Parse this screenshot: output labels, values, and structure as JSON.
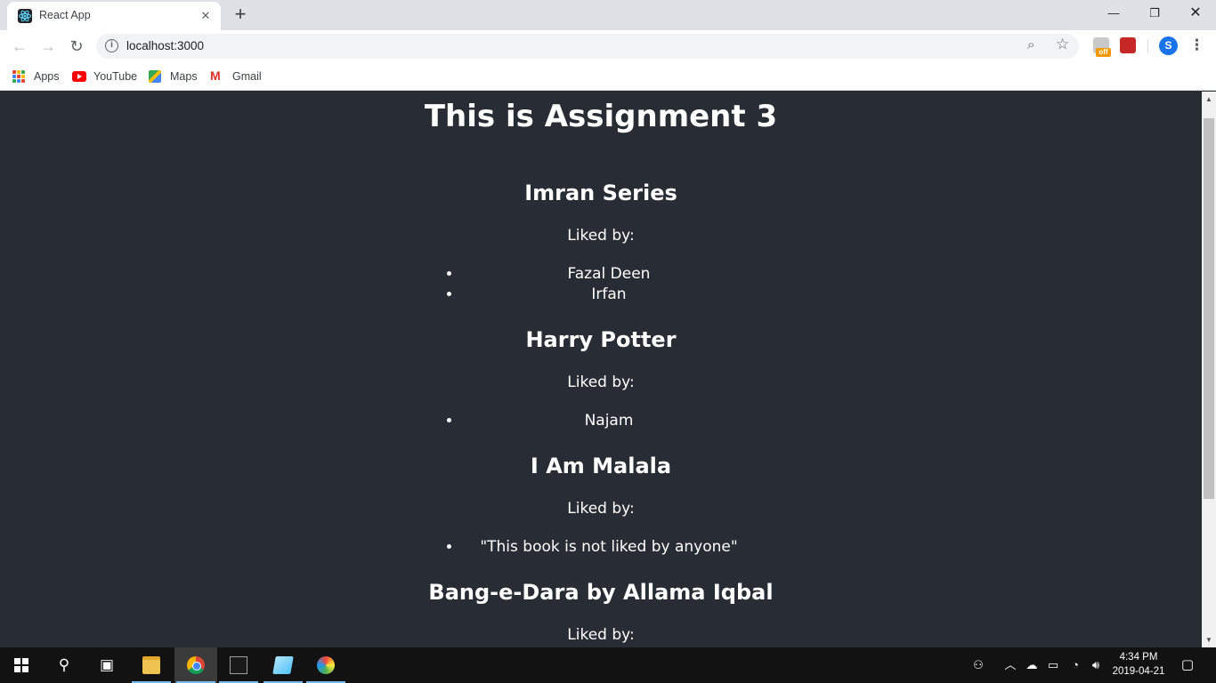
{
  "browser": {
    "tab_title": "React App",
    "url": "localhost:3000",
    "profile_initial": "S",
    "ext_badge": "off",
    "bookmarks": [
      "Apps",
      "YouTube",
      "Maps",
      "Gmail"
    ]
  },
  "page": {
    "title": "This is Assignment 3",
    "books": [
      {
        "title": "Imran Series",
        "liked_label": "Liked by:",
        "likers": [
          "Fazal Deen",
          "Irfan"
        ]
      },
      {
        "title": "Harry Potter",
        "liked_label": "Liked by:",
        "likers": [
          "Najam"
        ]
      },
      {
        "title": "I Am Malala",
        "liked_label": "Liked by:",
        "likers": [
          "\"This book is not liked by anyone\""
        ]
      },
      {
        "title": "Bang-e-Dara by Allama Iqbal",
        "liked_label": "Liked by:",
        "likers": []
      }
    ]
  },
  "taskbar": {
    "time": "4:34 PM",
    "date": "2019-04-21"
  },
  "colors": {
    "page_bg": "#282c34",
    "text": "#ffffff",
    "tabbar_bg": "#dee1e6",
    "taskbar_bg": "#121212",
    "accent": "#1a73e8"
  }
}
